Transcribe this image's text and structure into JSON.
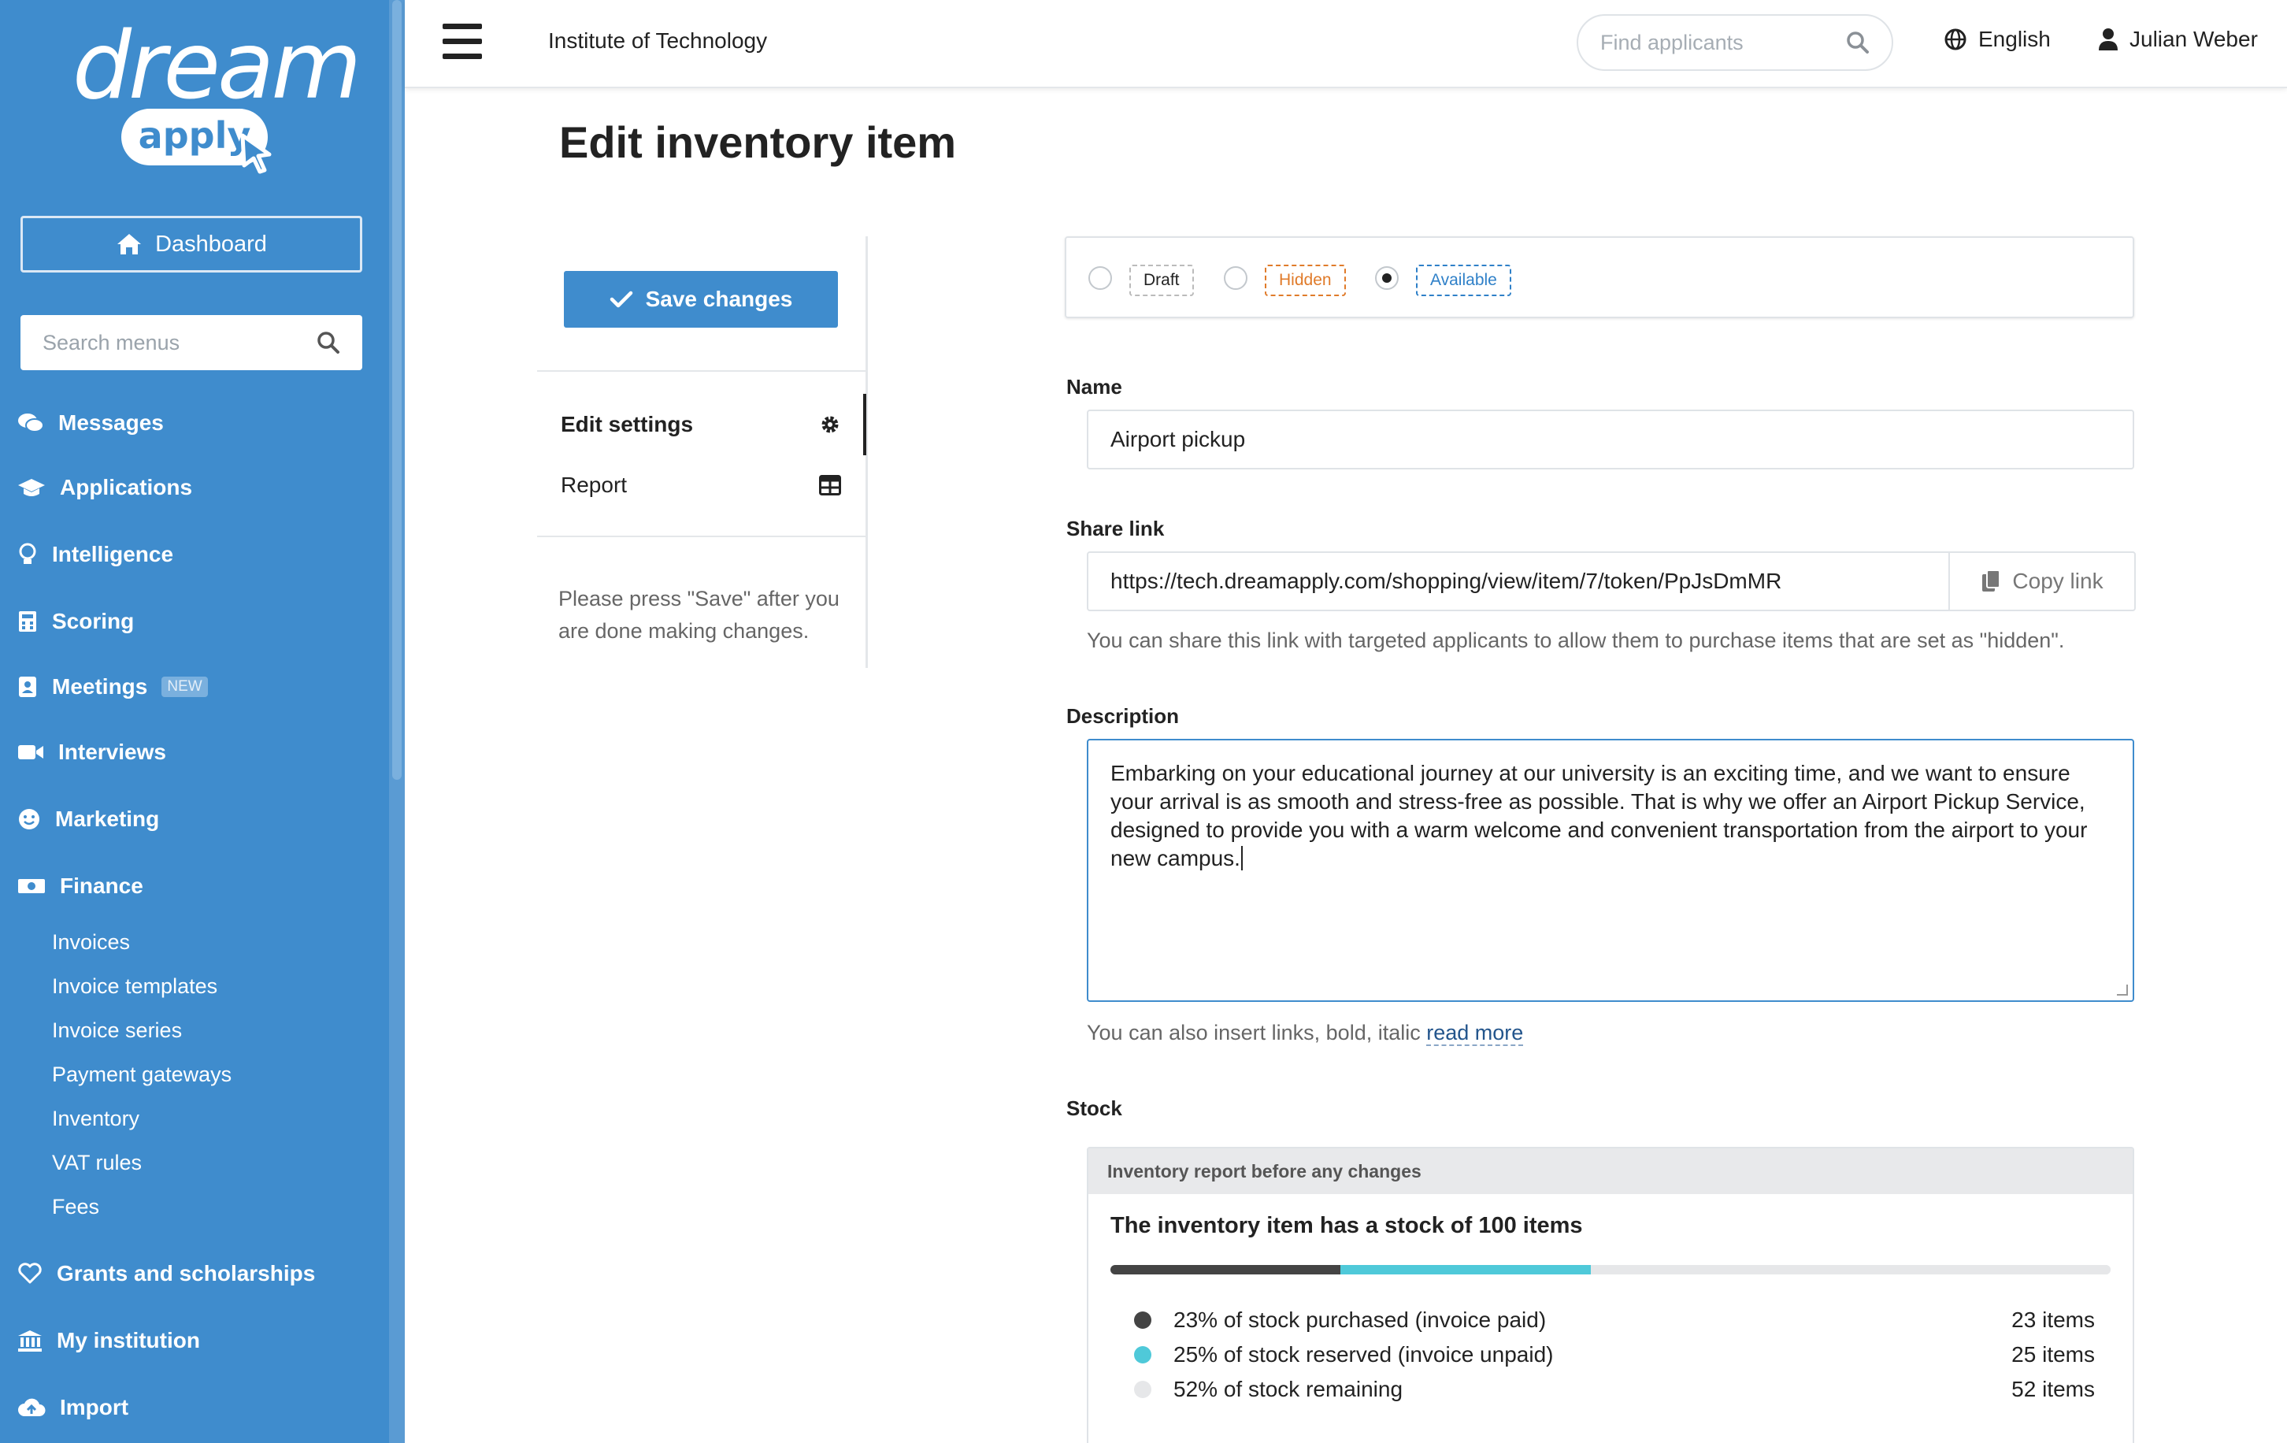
{
  "brand": {
    "logo_top": "dream",
    "logo_bottom": "apply"
  },
  "sidebar": {
    "dashboard_label": "Dashboard",
    "search_placeholder": "Search menus",
    "items": [
      {
        "label": "Messages",
        "icon": "chat-bubbles-icon"
      },
      {
        "label": "Applications",
        "icon": "graduation-cap-icon"
      },
      {
        "label": "Intelligence",
        "icon": "lightbulb-icon"
      },
      {
        "label": "Scoring",
        "icon": "calculator-icon"
      },
      {
        "label": "Meetings",
        "icon": "contact-card-icon",
        "badge": "NEW"
      },
      {
        "label": "Interviews",
        "icon": "video-camera-icon"
      },
      {
        "label": "Marketing",
        "icon": "smiley-icon"
      },
      {
        "label": "Finance",
        "icon": "money-bill-icon"
      },
      {
        "label": "Grants and scholarships",
        "icon": "heart-icon"
      },
      {
        "label": "My institution",
        "icon": "institution-icon"
      },
      {
        "label": "Import",
        "icon": "cloud-upload-icon"
      }
    ],
    "finance_sub": [
      "Invoices",
      "Invoice templates",
      "Invoice series",
      "Payment gateways",
      "Inventory",
      "VAT rules",
      "Fees"
    ]
  },
  "header": {
    "institution": "Institute of Technology",
    "find_placeholder": "Find applicants",
    "language": "English",
    "user": "Julian Weber"
  },
  "page": {
    "title": "Edit inventory item",
    "save_label": "Save changes",
    "menu": [
      {
        "label": "Edit settings",
        "icon": "gear-icon"
      },
      {
        "label": "Report",
        "icon": "table-icon"
      }
    ],
    "hint": "Please press \"Save\" after you are done making changes."
  },
  "form": {
    "statuses": [
      {
        "label": "Draft",
        "color": "#222222",
        "checked": false
      },
      {
        "label": "Hidden",
        "color": "#e07b2a",
        "checked": false
      },
      {
        "label": "Available",
        "color": "#2f80c8",
        "checked": true
      }
    ],
    "name_label": "Name",
    "name_value": "Airport pickup",
    "share_label": "Share link",
    "share_value": "https://tech.dreamapply.com/shopping/view/item/7/token/PpJsDmMR",
    "copy_label": "Copy link",
    "share_help": "You can share this link with targeted applicants to allow them to purchase items that are set as \"hidden\".",
    "description_label": "Description",
    "description_value": "Embarking on your educational journey at our university is an exciting time, and we want to ensure your arrival is as smooth and stress-free as possible. That is why we offer an Airport Pickup Service, designed to provide you with a warm welcome and convenient transportation from the airport to your new campus.",
    "description_help": "You can also insert links, bold, italic",
    "read_more": "read more",
    "stock_label": "Stock"
  },
  "stock": {
    "card_header": "Inventory report before any changes",
    "title": "The inventory item has a stock of 100 items",
    "segments": [
      {
        "label": "23% of stock purchased (invoice paid)",
        "count": "23 items",
        "percent": 23,
        "color": "#444444"
      },
      {
        "label": "25% of stock reserved (invoice unpaid)",
        "count": "25 items",
        "percent": 25,
        "color": "#4fc9d9"
      },
      {
        "label": "52% of stock remaining",
        "count": "52 items",
        "percent": 52,
        "color": "#e6e7e9"
      }
    ]
  },
  "colors": {
    "sidebar": "#3f8ccd",
    "accent": "#3f8ccd"
  }
}
